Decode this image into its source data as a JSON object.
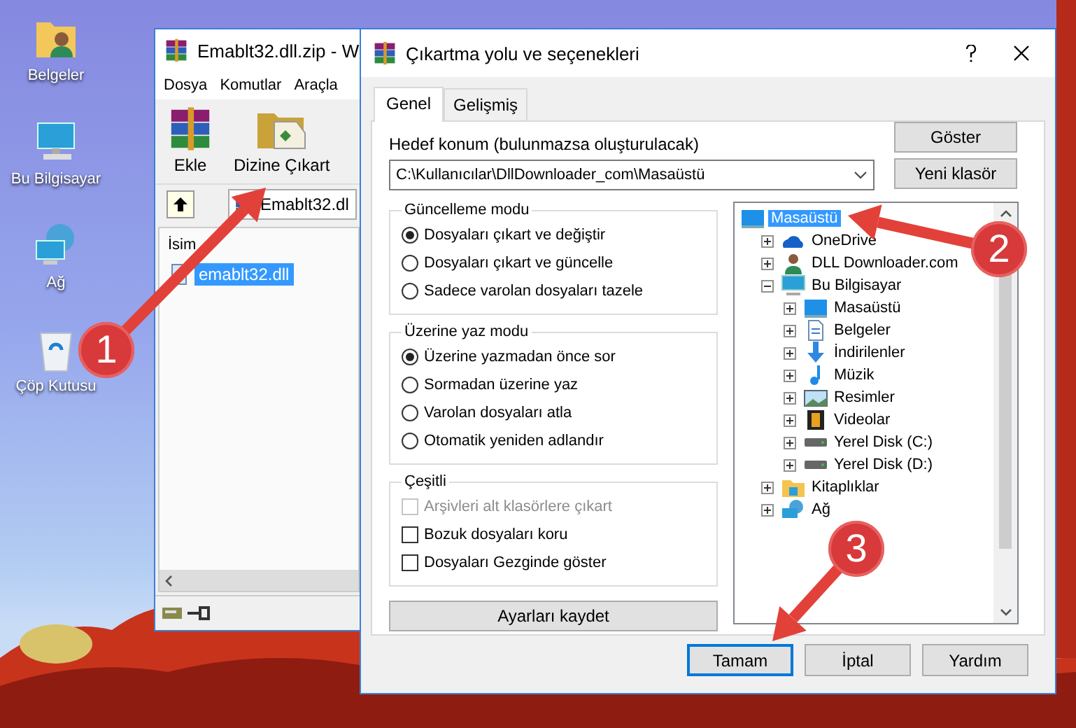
{
  "desktop_icons": [
    {
      "label": "Belgeler",
      "kind": "user-folder"
    },
    {
      "label": "Bu Bilgisayar",
      "kind": "computer"
    },
    {
      "label": "Ağ",
      "kind": "network"
    },
    {
      "label": "Çöp Kutusu",
      "kind": "recycle-bin"
    }
  ],
  "archive_window": {
    "title": "Emablt32.dll.zip - W",
    "menu": [
      "Dosya",
      "Komutlar",
      "Araçla"
    ],
    "toolbar": [
      {
        "label": "Ekle",
        "kind": "add"
      },
      {
        "label": "Dizine Çıkart",
        "kind": "extract"
      }
    ],
    "path": "Emablt32.dl",
    "column": "İsim",
    "files": [
      {
        "name": "emablt32.dll",
        "selected": true
      }
    ]
  },
  "dialog": {
    "title": "Çıkartma yolu ve seçenekleri",
    "tabs": [
      {
        "label": "Genel",
        "selected": true
      },
      {
        "label": "Gelişmiş",
        "selected": false
      }
    ],
    "destination": {
      "label": "Hedef konum (bulunmazsa oluşturulacak)",
      "value": "C:\\Kullanıcılar\\DllDownloader_com\\Masaüstü"
    },
    "side_buttons": [
      "Göster",
      "Yeni klasör"
    ],
    "groups": [
      {
        "title": "Güncelleme modu",
        "kind": "radio",
        "options": [
          {
            "label": "Dosyaları çıkart ve değiştir",
            "selected": true
          },
          {
            "label": "Dosyaları çıkart ve güncelle",
            "selected": false
          },
          {
            "label": "Sadece varolan dosyaları tazele",
            "selected": false
          }
        ]
      },
      {
        "title": "Üzerine yaz modu",
        "kind": "radio",
        "options": [
          {
            "label": "Üzerine yazmadan önce sor",
            "selected": true
          },
          {
            "label": "Sormadan üzerine yaz",
            "selected": false
          },
          {
            "label": "Varolan dosyaları atla",
            "selected": false
          },
          {
            "label": "Otomatik yeniden adlandır",
            "selected": false
          }
        ]
      },
      {
        "title": "Çeşitli",
        "kind": "checkbox",
        "options": [
          {
            "label": "Arşivleri alt klasörlere çıkart",
            "checked": false,
            "disabled": true
          },
          {
            "label": "Bozuk dosyaları koru",
            "checked": false,
            "disabled": false
          },
          {
            "label": "Dosyaları Gezginde göster",
            "checked": false,
            "disabled": false
          }
        ]
      }
    ],
    "save_button": "Ayarları kaydet",
    "tree": [
      {
        "label": "Masaüstü",
        "kind": "desktop",
        "selected": true,
        "children": [
          {
            "label": "OneDrive",
            "kind": "cloud",
            "selected": false,
            "expanded": false
          },
          {
            "label": "DLL Downloader.com",
            "kind": "user",
            "selected": false,
            "expanded": false
          },
          {
            "label": "Bu Bilgisayar",
            "kind": "computer",
            "selected": false,
            "expanded": true,
            "children": [
              {
                "label": "Masaüstü",
                "kind": "desktop",
                "selected": false,
                "expanded": false
              },
              {
                "label": "Belgeler",
                "kind": "document",
                "selected": false,
                "expanded": false
              },
              {
                "label": "İndirilenler",
                "kind": "download",
                "selected": false,
                "expanded": false
              },
              {
                "label": "Müzik",
                "kind": "music",
                "selected": false,
                "expanded": false
              },
              {
                "label": "Resimler",
                "kind": "picture",
                "selected": false,
                "expanded": false
              },
              {
                "label": "Videolar",
                "kind": "video",
                "selected": false,
                "expanded": false
              },
              {
                "label": "Yerel Disk (C:)",
                "kind": "drive",
                "selected": false,
                "expanded": false
              },
              {
                "label": "Yerel Disk (D:)",
                "kind": "drive",
                "selected": false,
                "expanded": false
              }
            ]
          },
          {
            "label": "Kitaplıklar",
            "kind": "library",
            "selected": false,
            "expanded": false
          },
          {
            "label": "Ağ",
            "kind": "network",
            "selected": false,
            "expanded": false
          }
        ]
      }
    ],
    "buttons": [
      {
        "label": "Tamam",
        "default": true
      },
      {
        "label": "İptal",
        "default": false
      },
      {
        "label": "Yardım",
        "default": false
      }
    ]
  },
  "callouts": [
    {
      "number": "1"
    },
    {
      "number": "2"
    },
    {
      "number": "3"
    }
  ]
}
